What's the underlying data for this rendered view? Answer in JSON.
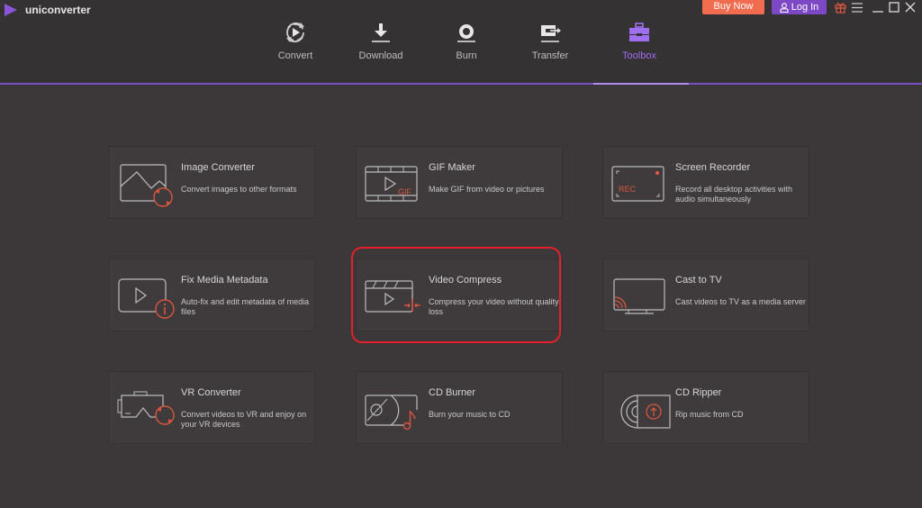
{
  "app": {
    "name": "uniconverter",
    "logo_icon": "play-logo-icon"
  },
  "header": {
    "buy_now": "Buy Now",
    "log_in": "Log In",
    "window_controls": [
      "gift-icon",
      "menu-icon",
      "minimize-icon",
      "maximize-icon",
      "close-icon"
    ]
  },
  "nav": {
    "tabs": [
      {
        "label": "Convert",
        "icon": "convert-icon",
        "active": false
      },
      {
        "label": "Download",
        "icon": "download-icon",
        "active": false
      },
      {
        "label": "Burn",
        "icon": "burn-icon",
        "active": false
      },
      {
        "label": "Transfer",
        "icon": "transfer-icon",
        "active": false
      },
      {
        "label": "Toolbox",
        "icon": "toolbox-icon",
        "active": true
      }
    ]
  },
  "colors": {
    "accent": "#7d48c6",
    "active_tab": "#9e6ff0",
    "buy": "#f26c4f",
    "icon_accent": "#d9553f",
    "highlight": "#e5202a"
  },
  "toolbox": {
    "cards": [
      {
        "title": "Image Converter",
        "desc": "Convert images to other formats",
        "icon": "image-converter-icon"
      },
      {
        "title": "GIF Maker",
        "desc": "Make GIF from video or pictures",
        "icon": "gif-maker-icon",
        "icon_text": "GIF"
      },
      {
        "title": "Screen Recorder",
        "desc": "Record all desktop activities with audio simultaneously",
        "icon": "screen-recorder-icon",
        "icon_text": "REC"
      },
      {
        "title": "Fix Media Metadata",
        "desc": "Auto-fix and edit metadata of media files",
        "icon": "fix-metadata-icon"
      },
      {
        "title": "Video Compress",
        "desc": "Compress your video without quality loss",
        "icon": "video-compress-icon",
        "highlighted": true
      },
      {
        "title": "Cast to TV",
        "desc": "Cast videos to TV as a media server",
        "icon": "cast-to-tv-icon"
      },
      {
        "title": "VR Converter",
        "desc": "Convert videos to VR and enjoy on your VR devices",
        "icon": "vr-converter-icon"
      },
      {
        "title": "CD Burner",
        "desc": "Burn your music to CD",
        "icon": "cd-burner-icon"
      },
      {
        "title": "CD Ripper",
        "desc": "Rip music from CD",
        "icon": "cd-ripper-icon"
      }
    ]
  }
}
